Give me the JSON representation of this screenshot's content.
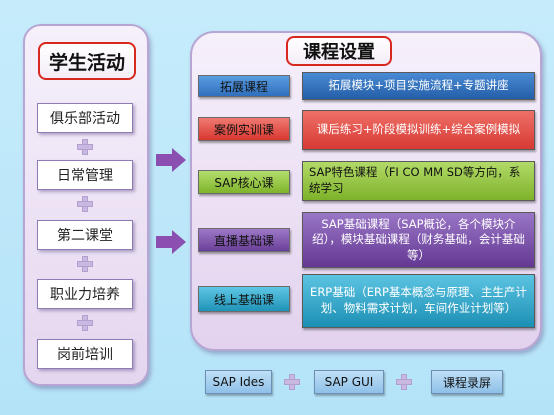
{
  "left": {
    "title": "学生活动",
    "items": [
      "俱乐部活动",
      "日常管理",
      "第二课堂",
      "职业力培养",
      "岗前培训"
    ]
  },
  "right": {
    "title": "课程设置",
    "courses": [
      {
        "label": "拓展课程",
        "desc": "拓展模块+项目实施流程+专题讲座",
        "label_color": "#3a7fc9",
        "desc_color": "#2f6fbd"
      },
      {
        "label": "案例实训课",
        "desc": "课后练习+阶段模拟训练+综合案例模拟",
        "label_color": "#e24a43",
        "desc_color": "#e0463f"
      },
      {
        "label": "SAP核心课",
        "desc": "SAP特色课程（FI CO MM SD等方向，系统学习",
        "label_color": "#8fc53a",
        "desc_color": "#8cc43a"
      },
      {
        "label": "直播基础课",
        "desc": "SAP基础课程（SAP概论，各个模块介绍），模块基础课程（财务基础，会计基础等）",
        "label_color": "#7a4fa8",
        "desc_color": "#7a4fa8"
      },
      {
        "label": "线上基础课",
        "desc": "ERP基础（ERP基本概念与原理、主生产计划、物料需求计划，车间作业计划等）",
        "label_color": "#2ba7c9",
        "desc_color": "#2aa5c8"
      }
    ]
  },
  "bottom": [
    "SAP Ides",
    "SAP GUI",
    "课程录屏"
  ],
  "colors": {
    "accent_border": "#d8281e",
    "arrow": "#8a4fb0",
    "background": "#c6ecfb"
  }
}
